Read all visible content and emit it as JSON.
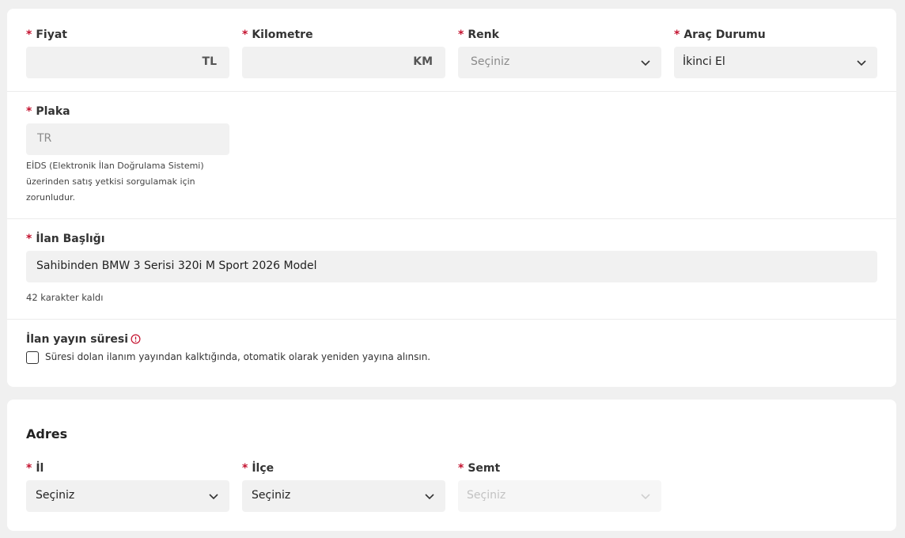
{
  "vehicle": {
    "price": {
      "label": "Fiyat",
      "required_mark": "*",
      "value": "",
      "suffix": "TL"
    },
    "mileage": {
      "label": "Kilometre",
      "required_mark": "*",
      "value": "",
      "suffix": "KM"
    },
    "color": {
      "label": "Renk",
      "required_mark": "*",
      "placeholder": "Seçiniz"
    },
    "condition": {
      "label": "Araç Durumu",
      "required_mark": "*",
      "value": "İkinci El"
    },
    "plate": {
      "label": "Plaka",
      "required_mark": "*",
      "placeholder": "TR",
      "help_lines": [
        "EİDS (Elektronik İlan Doğrulama Sistemi)",
        "üzerinden satış yetkisi sorgulamak için",
        "zorunludur."
      ]
    },
    "listing_title": {
      "label": "İlan Başlığı",
      "required_mark": "*",
      "value": "Sahibinden BMW 3 Serisi 320i M Sport 2026 Model",
      "counter": "42 karakter kaldı"
    },
    "duration": {
      "label": "İlan yayın süresi",
      "info_icon": "info-circle-icon",
      "auto_renew_label": "Süresi dolan ilanım yayından kalktığında, otomatik olarak yeniden yayına alınsın.",
      "auto_renew_checked": false
    }
  },
  "address": {
    "title": "Adres",
    "province": {
      "label": "İl",
      "required_mark": "*",
      "value": "Seçiniz"
    },
    "district": {
      "label": "İlçe",
      "required_mark": "*",
      "value": "Seçiniz"
    },
    "neighborhood": {
      "label": "Semt",
      "required_mark": "*",
      "placeholder": "Seçiniz",
      "disabled": true
    }
  },
  "colors": {
    "required": "#c4122f",
    "field_bg": "#f1f1f1",
    "page_bg": "#f0f0f0",
    "card_bg": "#ffffff"
  }
}
